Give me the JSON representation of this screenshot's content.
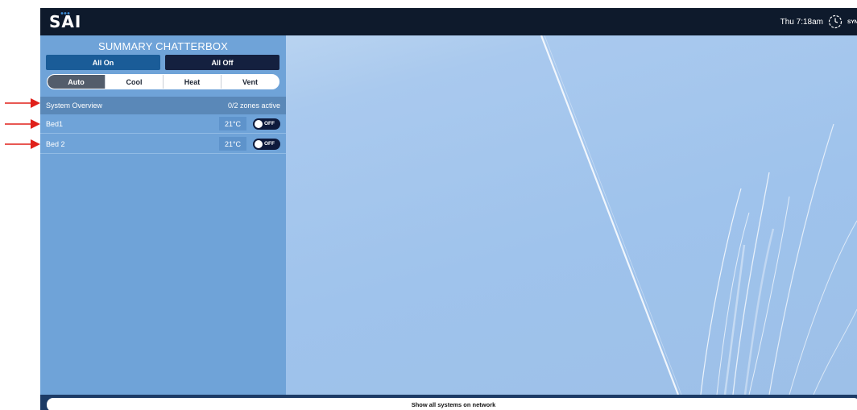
{
  "header": {
    "logo_text": "SAI",
    "time": "Thu 7:18am",
    "sync_label": "SYNC TIME"
  },
  "panel": {
    "title": "SUMMARY CHATTERBOX",
    "all_on_label": "All On",
    "all_off_label": "All Off",
    "modes": [
      {
        "label": "Auto",
        "active": true
      },
      {
        "label": "Cool",
        "active": false
      },
      {
        "label": "Heat",
        "active": false
      },
      {
        "label": "Vent",
        "active": false
      }
    ],
    "overview": {
      "label": "System Overview",
      "status": "0/2 zones active"
    },
    "zones": [
      {
        "name": "Bed1",
        "temperature": "21°C",
        "toggle_label": "OFF"
      },
      {
        "name": "Bed 2",
        "temperature": "21°C",
        "toggle_label": "OFF"
      }
    ]
  },
  "footer": {
    "show_all_label": "Show all systems on network"
  },
  "colors": {
    "topbar": "#0e1a2c",
    "panel": "#6fa3d8",
    "all_on": "#1a5c98",
    "all_off": "#14203f",
    "annotation_arrow": "#e0201a"
  }
}
